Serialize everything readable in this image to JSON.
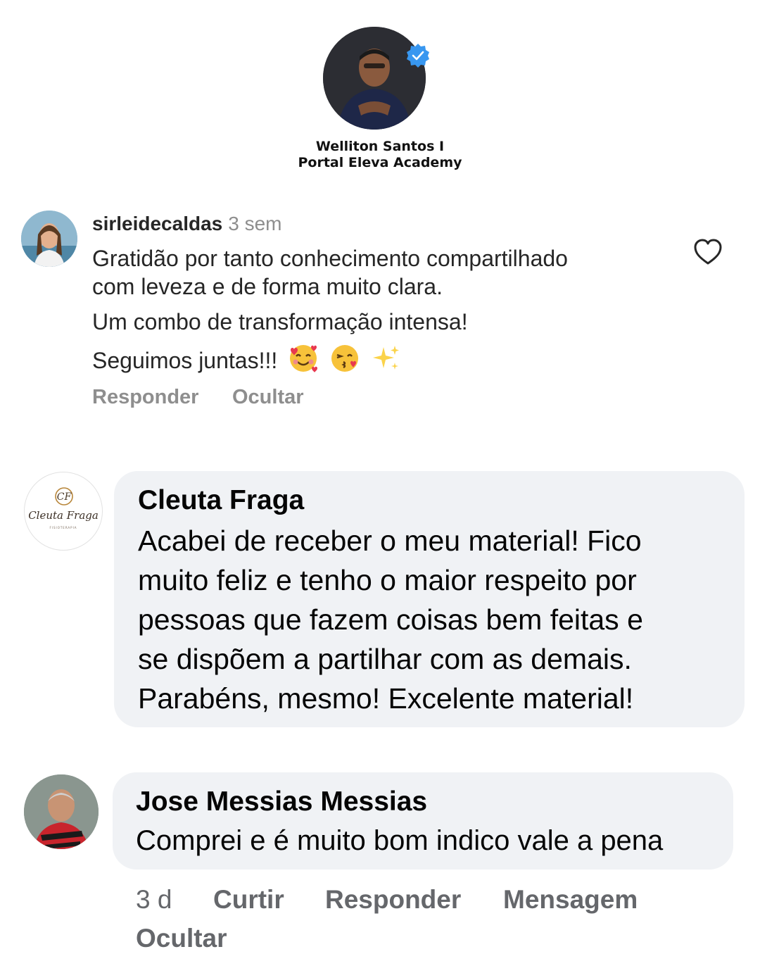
{
  "profile": {
    "name_line1": "Welliton Santos I",
    "name_line2": "Portal  Eleva Academy",
    "avatar": "profile-photo",
    "verified_icon": "verified-badge-icon",
    "verified_color": "#3897f0"
  },
  "ig_comment": {
    "username": "sirleidecaldas",
    "time": "3 sem",
    "lines": [
      "Gratidão por tanto conhecimento compartilhado",
      "com leveza e de forma muito clara.",
      "Um combo de transformação intensa!",
      "Seguimos juntas!!!"
    ],
    "emojis": [
      "smiling-face-with-hearts",
      "face-blowing-kiss",
      "sparkles"
    ],
    "actions": [
      "Responder",
      "Ocultar"
    ],
    "like_icon": "heart-outline-icon"
  },
  "fb_comments": [
    {
      "author": "Cleuta Fraga",
      "lines": [
        "Acabei de receber o meu material! Fico",
        "muito feliz e tenho o maior respeito por",
        "pessoas que fazem coisas bem feitas e",
        "se dispõem a partilhar com as demais.",
        "Parabéns, mesmo! Excelente material!"
      ],
      "logo_script": "Cleuta Fraga",
      "logo_monogram": "CF",
      "logo_sub": "FISIOTERAPIA"
    },
    {
      "author": "Jose Messias Messias",
      "lines": [
        "Comprei e é muito bom indico vale a pena"
      ],
      "time": "3 d",
      "actions": [
        "Curtir",
        "Responder",
        "Mensagem",
        "Ocultar"
      ]
    }
  ],
  "colors": {
    "bubble_bg": "#f0f2f5",
    "meta_gray": "#8e8e8e",
    "fb_meta_gray": "#65676b"
  }
}
